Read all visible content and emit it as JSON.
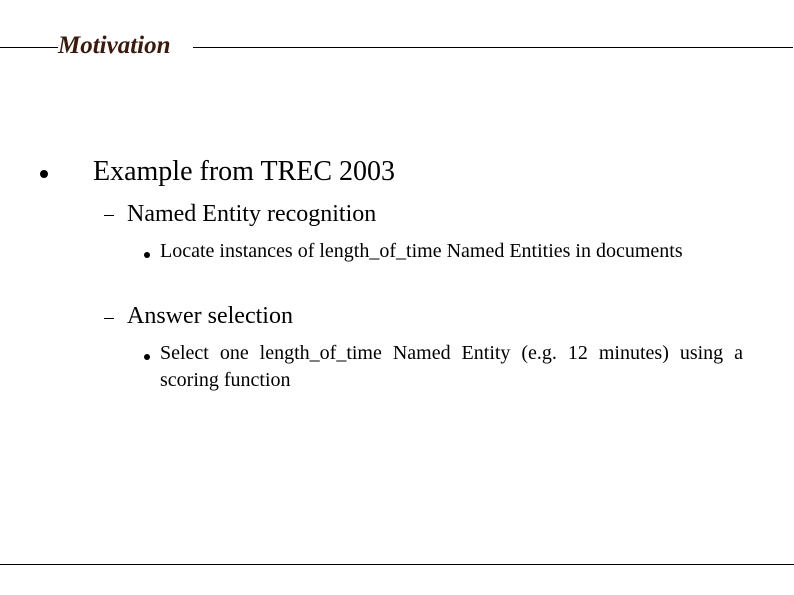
{
  "slide": {
    "title": "Motivation",
    "title_color": "#3b1a0c",
    "bullets": [
      {
        "text": "Example from TREC 2003",
        "children": [
          {
            "text": "Named Entity recognition",
            "children": [
              {
                "text": "Locate instances of length_of_time Named Entities in documents"
              }
            ]
          },
          {
            "text": "Answer selection",
            "children": [
              {
                "text": "Select one length_of_time Named Entity (e.g. 12 minutes) using a scoring function"
              }
            ]
          }
        ]
      }
    ]
  }
}
